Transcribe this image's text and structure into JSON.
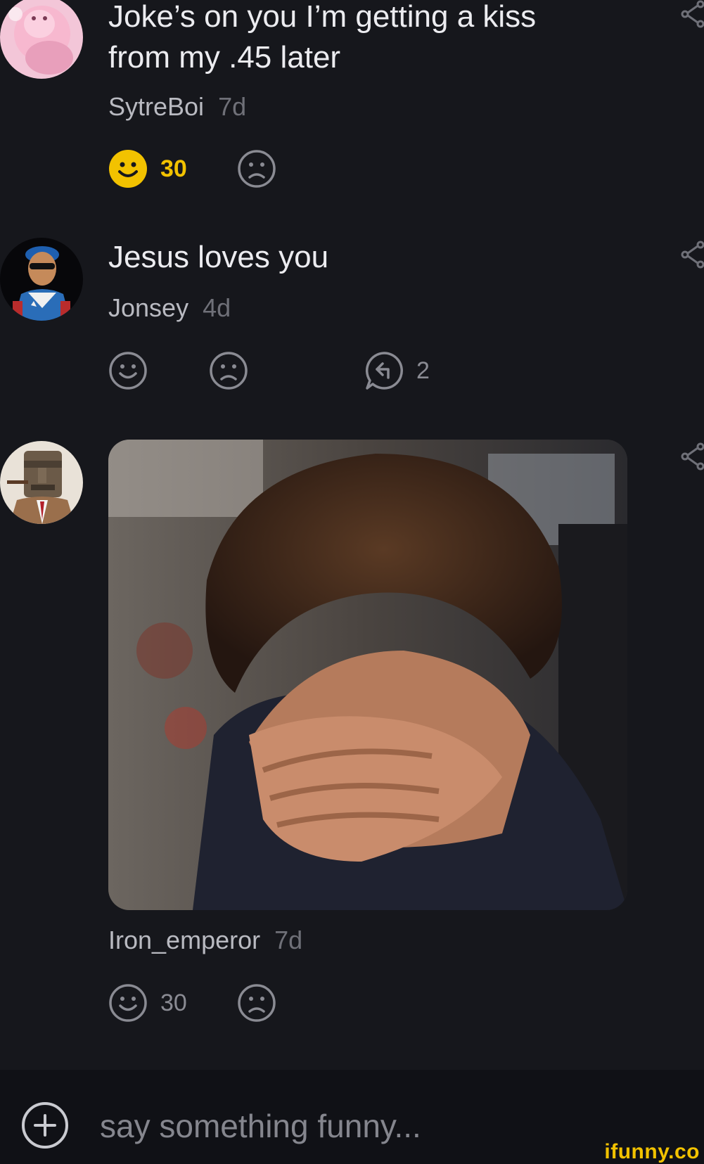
{
  "comments": [
    {
      "text": "Joke’s on you I’m getting a kiss\nfrom my .45 later",
      "user": "SytreBoi",
      "age": "7d",
      "smile_count": "30",
      "smile_active": true
    },
    {
      "text": "Jesus loves you",
      "user": "Jonsey",
      "age": "4d",
      "reply_count": "2"
    },
    {
      "user": "Iron_emperor",
      "age": "7d",
      "smile_count": "30"
    }
  ],
  "composer": {
    "placeholder": "say something funny..."
  },
  "watermark": "ifunny.co",
  "colors": {
    "background": "#16171c",
    "bottom_bar": "#101116",
    "accent_yellow": "#f2c200",
    "icon_gray": "#8a8b93"
  },
  "icons": [
    "share-icon",
    "smile-icon",
    "frown-icon",
    "reply-icon",
    "plus-circle-icon"
  ]
}
